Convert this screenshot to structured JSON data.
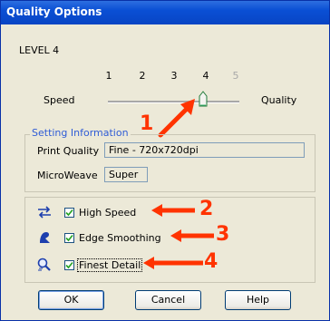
{
  "window": {
    "title": "Quality Options"
  },
  "level_label": "LEVEL 4",
  "slider": {
    "ticks": [
      "1",
      "2",
      "3",
      "4",
      "5"
    ],
    "value": 4,
    "min_label": "Speed",
    "max_label": "Quality"
  },
  "setting_info": {
    "group_label": "Setting Information",
    "print_quality_label": "Print Quality",
    "print_quality_value": "Fine - 720x720dpi",
    "microweave_label": "MicroWeave",
    "microweave_value": "Super"
  },
  "options": [
    {
      "label": "High Speed",
      "checked": true,
      "icon": "high-speed-icon"
    },
    {
      "label": "Edge Smoothing",
      "checked": true,
      "icon": "edge-smoothing-icon"
    },
    {
      "label": "Finest Detail",
      "checked": true,
      "icon": "finest-detail-icon"
    }
  ],
  "callouts": [
    "1",
    "2",
    "3",
    "4"
  ],
  "buttons": {
    "ok": "OK",
    "cancel": "Cancel",
    "help": "Help"
  },
  "colors": {
    "title_bar": "#0a4fd4",
    "callout": "#ff3300",
    "group_label": "#2f5cd6"
  }
}
